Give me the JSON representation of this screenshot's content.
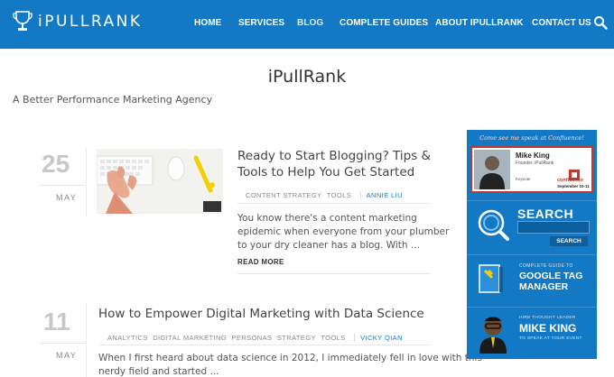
{
  "header": {
    "logo_text": "iPULLRANK",
    "nav": [
      {
        "label": "HOME"
      },
      {
        "label": "SERVICES"
      },
      {
        "label": "BLOG"
      },
      {
        "label": "COMPLETE GUIDES"
      },
      {
        "label": "ABOUT IPULLRANK"
      },
      {
        "label": "CONTACT US"
      }
    ],
    "colors": {
      "bar": "#1479c4",
      "text": "#ffffff"
    }
  },
  "site": {
    "title": "iPullRank",
    "tagline": "A Better Performance Marketing Agency"
  },
  "posts": [
    {
      "day": "25",
      "month": "MAY",
      "title_lines": [
        "Ready to Start Blogging? Tips &",
        "Tools to Help You Get Started"
      ],
      "categories": [
        "CONTENT STRATEGY",
        "TOOLS"
      ],
      "author": "ANNIE LIU",
      "excerpt_lines": [
        "You know there's a content marketing",
        "epidemic when everyone from your plumber",
        "to your dry cleaner has a blog. With ..."
      ],
      "read_more": "READ MORE"
    },
    {
      "day": "11",
      "month": "MAY",
      "title_lines": [
        "How to Empower Digital Marketing with Data Science"
      ],
      "categories": [
        "ANALYTICS",
        "DIGITAL MARKETING",
        "PERSONAS",
        "STRATEGY",
        "TOOLS"
      ],
      "author": "VICKY QIAN",
      "excerpt_lines": [
        "When I first heard about data science in 2012, I immediately fell in love with this",
        "nerdy field and started ..."
      ]
    }
  ],
  "sidebar": {
    "conference": {
      "heading": "Come see me speak at Confluence!",
      "name": "Mike King",
      "role": "Founder, iPullRank",
      "keynote": "Keynote",
      "event": "confluence",
      "dates": "September 10-11"
    },
    "search": {
      "title": "SEARCH",
      "button": "SEARCH"
    },
    "guide": {
      "sub": "COMPLETE GUIDE TO",
      "title_lines": [
        "GOOGLE TAG",
        "MANAGER"
      ]
    },
    "hire": {
      "sub": "HIRE THOUGHT LEADER",
      "name": "MIKE KING",
      "foot": "TO SPEAK AT YOUR EVENT"
    },
    "color": "#1479c4"
  }
}
